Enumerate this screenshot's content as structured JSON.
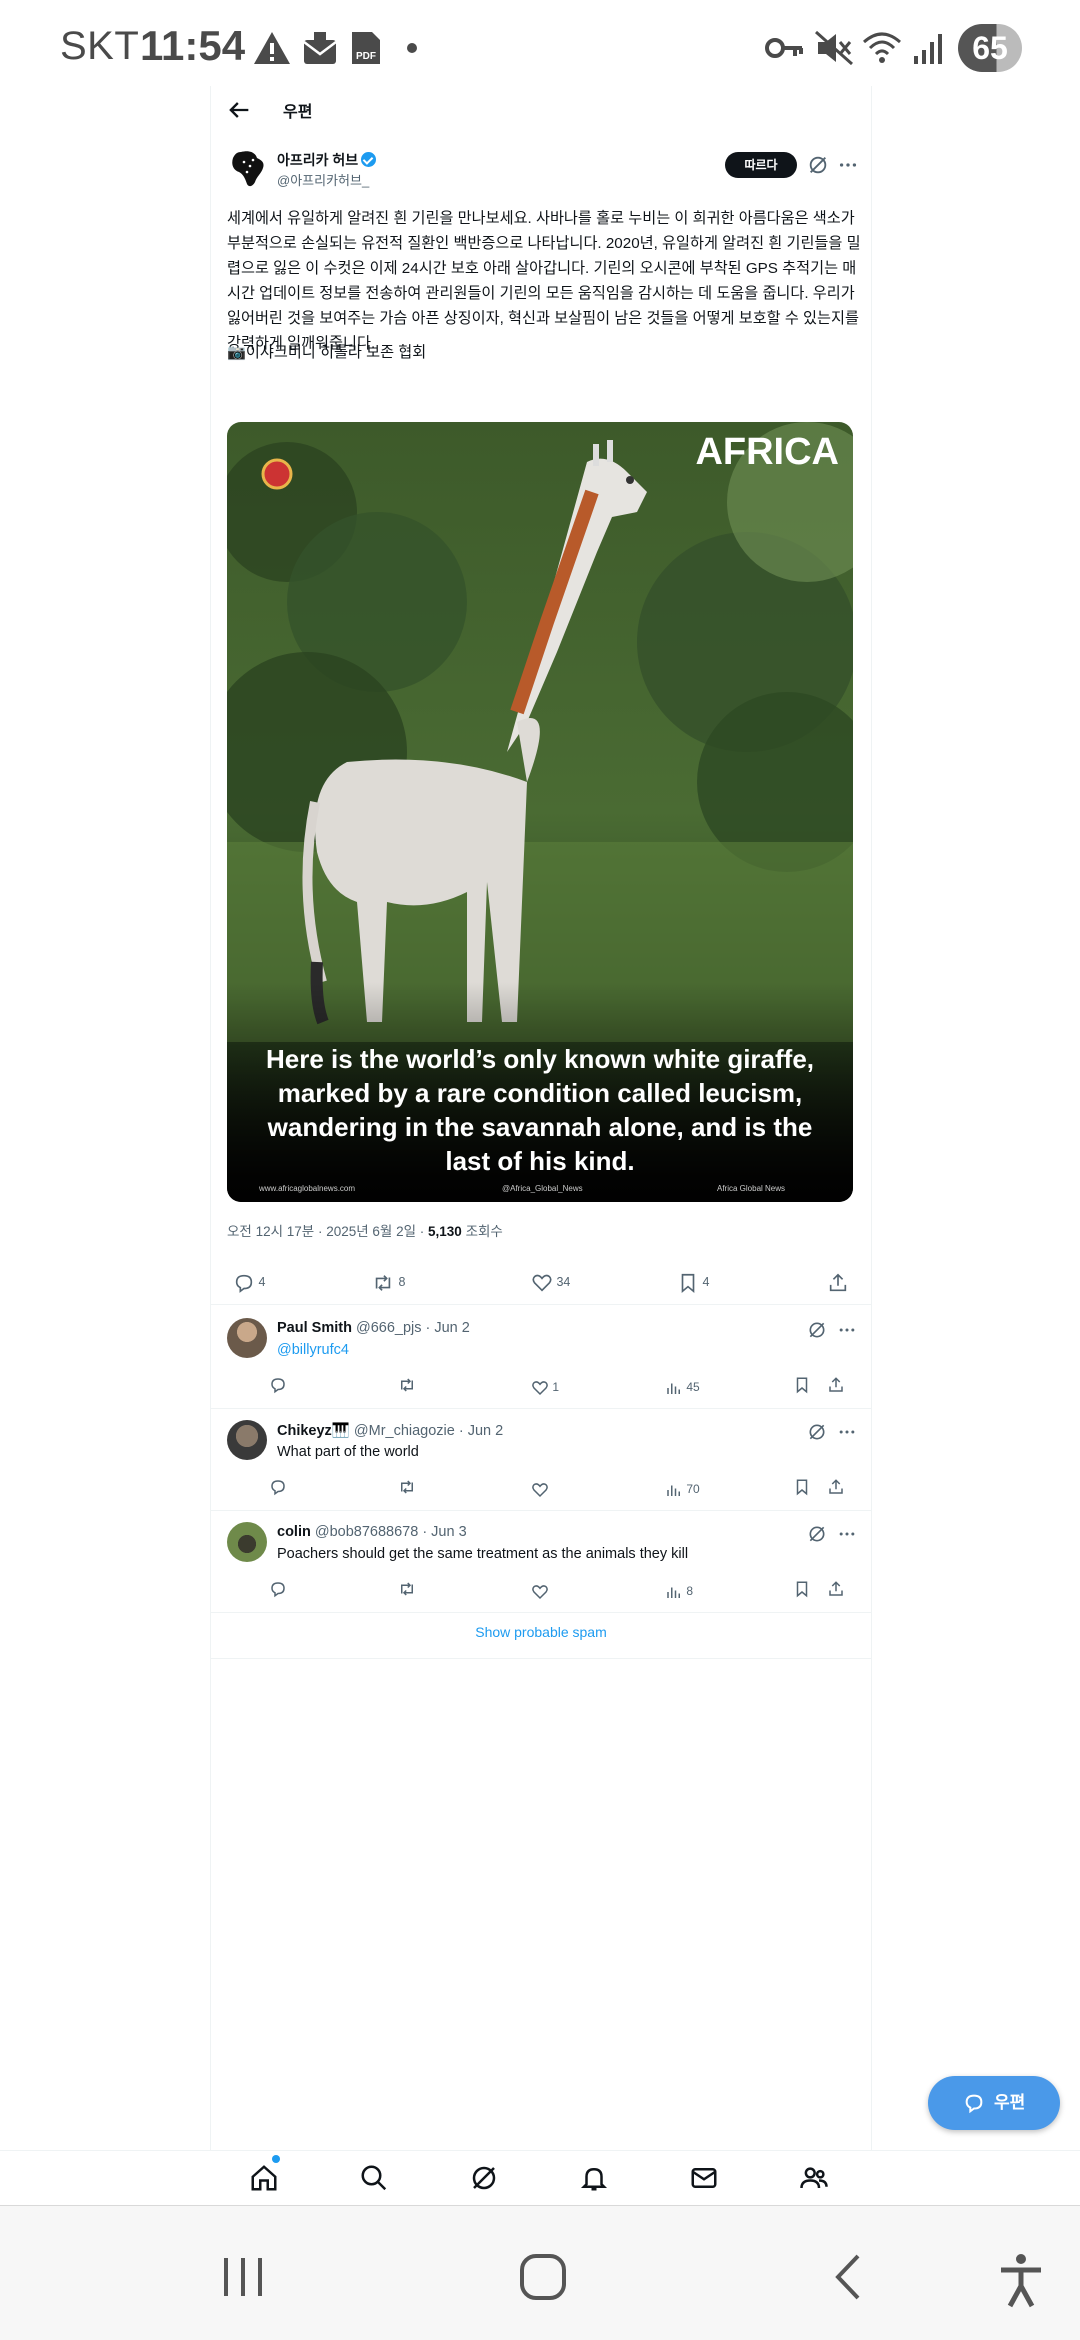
{
  "status_bar": {
    "carrier": "SKT",
    "time": "11:54",
    "battery": "65"
  },
  "header": {
    "title": "우편"
  },
  "tweet": {
    "author_name": "아프리카 허브",
    "author_handle": "@아프리카허브_",
    "follow_label": "따르다",
    "text": "세계에서 유일하게 알려진 흰 기린을 만나보세요. 사바나를 홀로 누비는 이 희귀한 아름다움은 색소가 부분적으로 손실되는 유전적 질환인 백반증으로 나타납니다. 2020년, 유일하게 알려진 흰 기린들을 밀렵으로 잃은 이 수컷은 이제 24시간 보호 아래 살아갑니다. 기린의 오시콘에 부착된 GPS 추적기는 매시간 업데이트 정보를 전송하여 관리원들이 기린의 모든 움직임을 감시하는 데 도움을 줍니다. 우리가 잃어버린 것을 보여주는 가슴 아픈 상징이자, 혁신과 보살핌이 남은 것들을 어떻게 보호할 수 있는지를 강력하게 일깨워줍니다.",
    "credit": "📷이샤크비니 히롤라 보존 협회",
    "image": {
      "brand": "AFRICA",
      "caption": "Here is the world’s only known white giraffe, marked by a rare condition called leucism, wandering in the savannah alone, and is the last of his kind.",
      "footer_website": "www.africaglobalnews.com",
      "footer_instagram": "@Africa_Global_News",
      "footer_facebook": "Africa Global News"
    },
    "timestamp": "오전 12시 17분 · 2025년 6월 2일 · ",
    "views_count": "5,130",
    "views_label": " 조회수",
    "counts": {
      "replies": "4",
      "reposts": "8",
      "likes": "34",
      "bookmarks": "4"
    }
  },
  "replies": [
    {
      "name": "Paul Smith",
      "handle": "@666_pjs · Jun 2",
      "text": "@billyrufc4",
      "likes": "1",
      "views": "45"
    },
    {
      "name": "Chikeyz🎹",
      "handle": "@Mr_chiagozie · Jun 2",
      "text": "What part of the world",
      "likes": "",
      "views": "70"
    },
    {
      "name": "colin",
      "handle": "@bob87688678 · Jun 3",
      "text": "Poachers should get the same treatment as the animals they kill",
      "likes": "",
      "views": "8"
    }
  ],
  "show_spam_label": "Show probable spam",
  "fab_label": "우편",
  "colors": {
    "accent": "#1d9bf0",
    "fab": "#4a99e9",
    "text": "#0f1419",
    "secondary": "#536471"
  }
}
